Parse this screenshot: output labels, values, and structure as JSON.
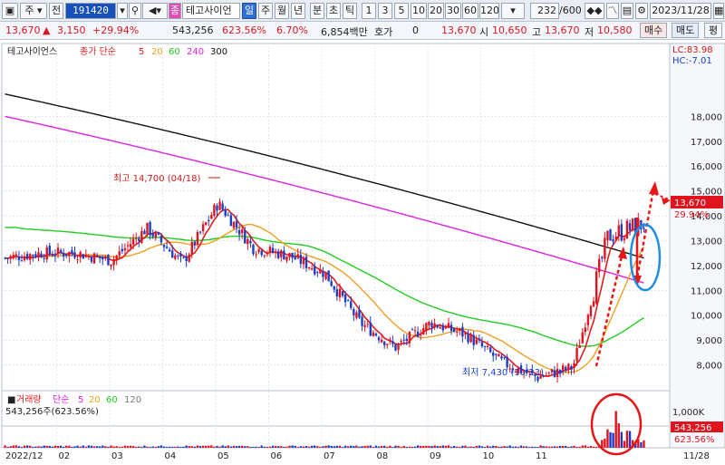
{
  "toolbar": {
    "menu_icon": "window-menu-icon",
    "market_label": "주",
    "market_toggle": "전",
    "stock_code": "191420",
    "stock_name": "테고사이언",
    "badge": "종",
    "periods": [
      "일",
      "주",
      "월",
      "년",
      "분",
      "초",
      "틱"
    ],
    "active_period": "일",
    "intervals": [
      "1",
      "3",
      "5",
      "10",
      "20",
      "30",
      "60",
      "120"
    ],
    "count": "232",
    "count_total": "/600",
    "date": "2023/11/28"
  },
  "quote": {
    "price": "13,670",
    "change": "3,150",
    "change_pct": "+29.94%",
    "volume": "543,256",
    "volume_pct": "623.56%",
    "turnover_pct": "6.70%",
    "amount": "6,854백만",
    "hoga_label": "호가",
    "hoga_value": "0",
    "current": "13,670",
    "open_label": "시",
    "open": "10,650",
    "high_label": "고",
    "high": "13,670",
    "low_label": "저",
    "low": "10,580",
    "buy_label": "매수",
    "sell_label": "매도",
    "eval_label": "평"
  },
  "price_legend": {
    "name": "테고사이언스",
    "label": "종가 단순",
    "periods": [
      {
        "value": "5",
        "color": "#e11d1d"
      },
      {
        "value": "20",
        "color": "#f0a020"
      },
      {
        "value": "60",
        "color": "#22cc22"
      },
      {
        "value": "240",
        "color": "#e020e0"
      },
      {
        "value": "300",
        "color": "#111111"
      }
    ]
  },
  "volume_legend": {
    "label": "거래량",
    "label2": "단순",
    "periods": [
      {
        "value": "5",
        "color": "#e020e0"
      },
      {
        "value": "20",
        "color": "#f0a020"
      },
      {
        "value": "60",
        "color": "#22cc22"
      },
      {
        "value": "120",
        "color": "#777777"
      }
    ],
    "value_text": "543,256주(623.56%)"
  },
  "chart_data": [
    {
      "type": "candlestick",
      "title": "테고사이언스 종가 단순 5 20 60 240 300",
      "y_ticks": [
        "8,000",
        "9,000",
        "10,000",
        "11,000",
        "12,000",
        "13,000",
        "14,000",
        "15,000",
        "16,000",
        "17,000",
        "18,000"
      ],
      "ylim": [
        7000,
        19400
      ],
      "x_ticks": [
        "2022/12",
        "02",
        "03",
        "04",
        "05",
        "06",
        "07",
        "08",
        "09",
        "10",
        "11",
        "11/28"
      ],
      "lc": "LC:83.98",
      "hc": "HC:-7.01",
      "current_tag": "13,670",
      "current_pct": "29.94%",
      "last_close": 13670,
      "annotations": {
        "high_label": "최고 14,700 (04/18)",
        "high_value": 14700,
        "low_label": "최저 7,430 (10/23)",
        "low_value": 7430
      },
      "close_series": [
        {
          "x": "2022/12",
          "y": 12300
        },
        {
          "x": "2023/01",
          "y": 12500
        },
        {
          "x": "2023/02",
          "y": 12500
        },
        {
          "x": "2023/03",
          "y": 12200
        },
        {
          "x": "2023/03 late",
          "y": 13500
        },
        {
          "x": "2023/04",
          "y": 12100
        },
        {
          "x": "2023/04/18",
          "y": 14500
        },
        {
          "x": "2023/05",
          "y": 12700
        },
        {
          "x": "2023/06",
          "y": 12400
        },
        {
          "x": "2023/07",
          "y": 11700
        },
        {
          "x": "2023/07 late",
          "y": 9700
        },
        {
          "x": "2023/08",
          "y": 8700
        },
        {
          "x": "2023/08 late",
          "y": 9700
        },
        {
          "x": "2023/09",
          "y": 9200
        },
        {
          "x": "2023/10",
          "y": 8100
        },
        {
          "x": "2023/10/23",
          "y": 7500
        },
        {
          "x": "2023/11 early",
          "y": 7900
        },
        {
          "x": "2023/11 mid",
          "y": 13200
        },
        {
          "x": "2023/11/28",
          "y": 13670
        }
      ],
      "moving_averages": [
        {
          "name": "300",
          "color": "#111111",
          "start": 18900,
          "end": 12300
        },
        {
          "name": "240",
          "color": "#e020e0",
          "start": 18000,
          "end": 11300
        },
        {
          "name": "60",
          "color": "#22cc22",
          "start": 15400,
          "end": 9100
        },
        {
          "name": "20",
          "color": "#f0a020",
          "start": 13800,
          "end": 9900
        },
        {
          "name": "5",
          "color": "#e11d1d",
          "start": 12300,
          "end": 12200
        }
      ]
    },
    {
      "type": "bar",
      "title": "거래량 단순 5 20 60 120",
      "y_ticks": [
        "1,000K"
      ],
      "ylim": [
        0,
        1500
      ],
      "unit": "K",
      "last_value_tag": "543,256",
      "last_pct_tag": "623.56%",
      "peak": 1350
    }
  ]
}
